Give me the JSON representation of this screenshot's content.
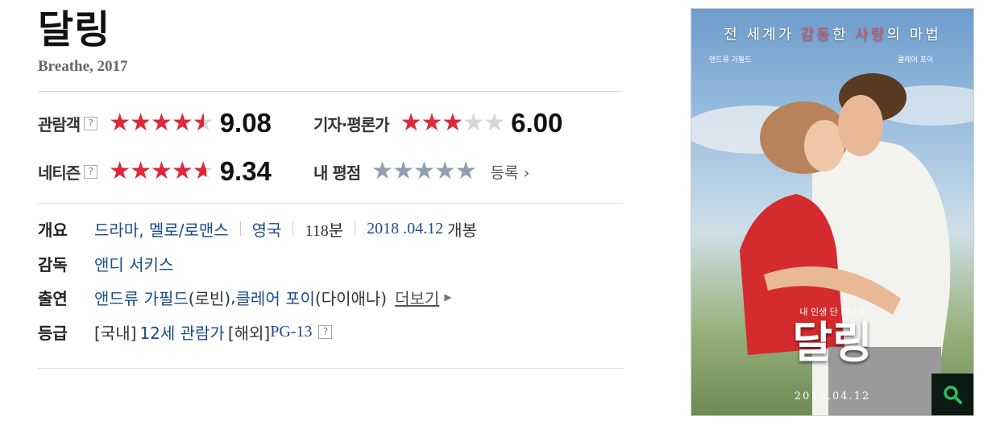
{
  "movie": {
    "title": "달링",
    "original_title_year": "Breathe, 2017"
  },
  "ratings": {
    "audience": {
      "label": "관람객",
      "help": "?",
      "score": "9.08",
      "stars_fraction": 0.908
    },
    "critic": {
      "label": "기자·평론가",
      "score": "6.00",
      "stars_fraction": 0.6
    },
    "netizen": {
      "label": "네티즌",
      "help": "?",
      "score": "9.34",
      "stars_fraction": 0.934
    },
    "mine": {
      "label": "내 평점",
      "register_label": "등록"
    }
  },
  "info": {
    "summary": {
      "label": "개요",
      "genre": "드라마, 멜로/로맨스",
      "country": "영국",
      "runtime": "118분",
      "release_date": "2018 .04.12",
      "release_suffix": "개봉"
    },
    "director": {
      "label": "감독",
      "name": "앤디 서키스"
    },
    "cast": {
      "label": "출연",
      "actor1": "앤드류 가필드",
      "role1": "(로빈)",
      "actor2": "클레어 포이",
      "role2": "(다이애나)",
      "more_label": "더보기"
    },
    "grade": {
      "label": "등급",
      "domestic_prefix": "[국내]",
      "domestic": "12세 관람가",
      "overseas_prefix": "[해외]",
      "overseas": "PG-13",
      "help": "?"
    }
  },
  "poster": {
    "tagline_part1": "전 세계가 ",
    "tagline_hl1": "감동",
    "tagline_part2": "한 ",
    "tagline_hl2": "사랑",
    "tagline_part3": "의 마법",
    "credit_left": "앤드류 가필드",
    "credit_right": "클레어 포이",
    "logo_sub": "내 인생 단 하나의",
    "logo": "달링",
    "date": "2018.04.12"
  },
  "colors": {
    "star_red": "#e0283a",
    "star_gray": "#d6d6d6",
    "star_blue": "#8fa0b0",
    "link_blue": "#1a4b8c"
  }
}
